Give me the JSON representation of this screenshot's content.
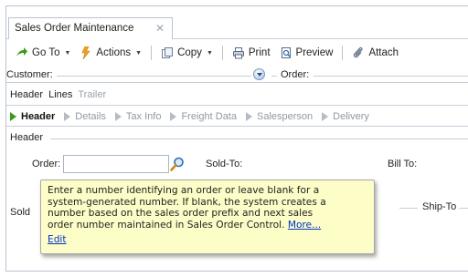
{
  "tab": {
    "title": "Sales Order Maintenance",
    "close": "✕"
  },
  "toolbar": {
    "goto": "Go To",
    "actions": "Actions",
    "copy": "Copy",
    "print": "Print",
    "preview": "Preview",
    "attach": "Attach"
  },
  "customer_row": {
    "customer": "Customer:",
    "order": "Order:"
  },
  "subtabs": [
    "Header",
    "Lines",
    "Trailer"
  ],
  "workflow": [
    "Header",
    "Details",
    "Tax Info",
    "Freight Data",
    "Salesperson",
    "Delivery"
  ],
  "section": "Header",
  "fields": {
    "order_label": "Order:",
    "order_value": "",
    "sold_to": "Sold-To:",
    "bill_to": "Bill To:",
    "sold_frag": "Sold",
    "ship_to": "Ship-To"
  },
  "tooltip": {
    "line1": "Enter a number identifying an order or leave blank for a",
    "line2": "system-generated number. If blank, the system creates a",
    "line3": "number based on the sales order prefix and next sales",
    "line4": "order number maintained in Sales Order Control.",
    "more": "More...",
    "edit": "Edit"
  },
  "colors": {
    "accent_green": "#3a9a1d",
    "link": "#0033cc",
    "tooltip_bg": "#fdfdc8"
  }
}
